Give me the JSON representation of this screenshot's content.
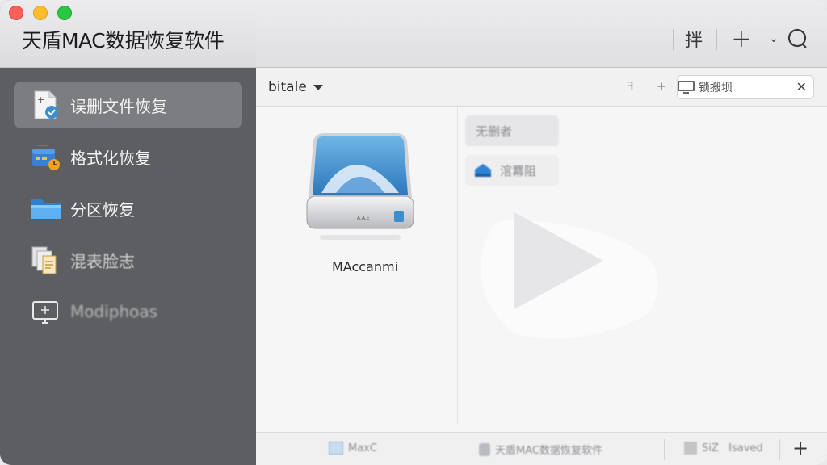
{
  "app": {
    "title": "天盾MAC数据恢复软件"
  },
  "header": {
    "sort_glyph": "拌",
    "add_glyph": "+",
    "chevron_glyph": "⌄"
  },
  "sidebar": {
    "items": [
      {
        "label": "误删文件恢复",
        "icon": "document-check-icon",
        "active": true
      },
      {
        "label": "格式化恢复",
        "icon": "format-drive-icon",
        "active": false
      },
      {
        "label": "分区恢复",
        "icon": "folder-icon",
        "active": false
      },
      {
        "label": "混表脸志",
        "icon": "files-icon",
        "active": false
      },
      {
        "label": "Modiphoas",
        "icon": "monitor-icon",
        "active": false
      }
    ]
  },
  "toolbar": {
    "location": "bitale",
    "filter_glyph": "ꟻ",
    "plus_glyph": "+",
    "search_value": "锁搬坝",
    "clear_glyph": "✕"
  },
  "content": {
    "drive_label": "MAccanmi",
    "drive_badge": "A.A.E",
    "chips": [
      "无删者",
      "涫羃阻"
    ]
  },
  "footer": {
    "items": [
      "MaxC",
      "天盾MAC数据恢复软件",
      "SiZ   Isaved"
    ],
    "add_glyph": "+"
  },
  "colors": {
    "sidebar_bg": "#5d5e61",
    "sidebar_active": "#7c7d80",
    "traffic_red": "#fe5f57",
    "traffic_yellow": "#febc2e",
    "traffic_green": "#28c840",
    "drive_blue": "#3a8fd0"
  }
}
